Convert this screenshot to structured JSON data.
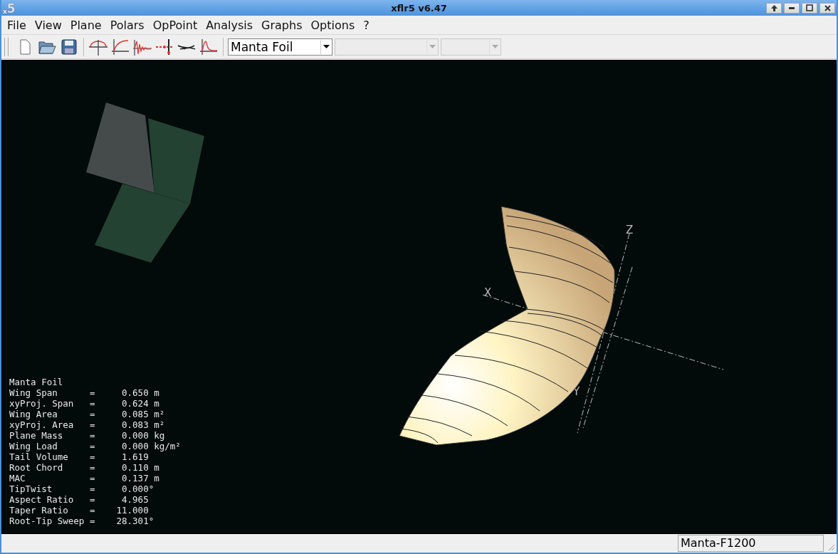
{
  "window": {
    "title": "xflr5 v6.47",
    "logo": {
      "main": "5",
      "sub": "x"
    }
  },
  "menu": [
    "File",
    "View",
    "Plane",
    "Polars",
    "OpPoint",
    "Analysis",
    "Graphs",
    "Options",
    "?"
  ],
  "toolbar": {
    "combos": [
      {
        "value": "Manta Foil",
        "disabled": false
      },
      {
        "disabled": true
      },
      {
        "disabled": true
      }
    ]
  },
  "view": {
    "axes": {
      "x": "X",
      "y": "Y",
      "z": "Z"
    },
    "info": [
      "Manta Foil",
      "Wing Span      =     0.650 m",
      "xyProj. Span   =     0.624 m",
      "Wing Area      =     0.085 m²",
      "xyProj. Area   =     0.083 m²",
      "Plane Mass     =     0.000 kg",
      "Wing Load      =     0.000 kg/m²",
      "Tail Volume    =     1.619",
      "Root Chord     =     0.110 m",
      "MAC            =     0.137 m",
      "TipTwist       =     0.000°",
      "Aspect Ratio   =     4.965",
      "Taper Ratio    =    11.000",
      "Root-Tip Sweep =    28.301°"
    ]
  },
  "status_bar": {
    "plane": "Manta-F1200"
  }
}
